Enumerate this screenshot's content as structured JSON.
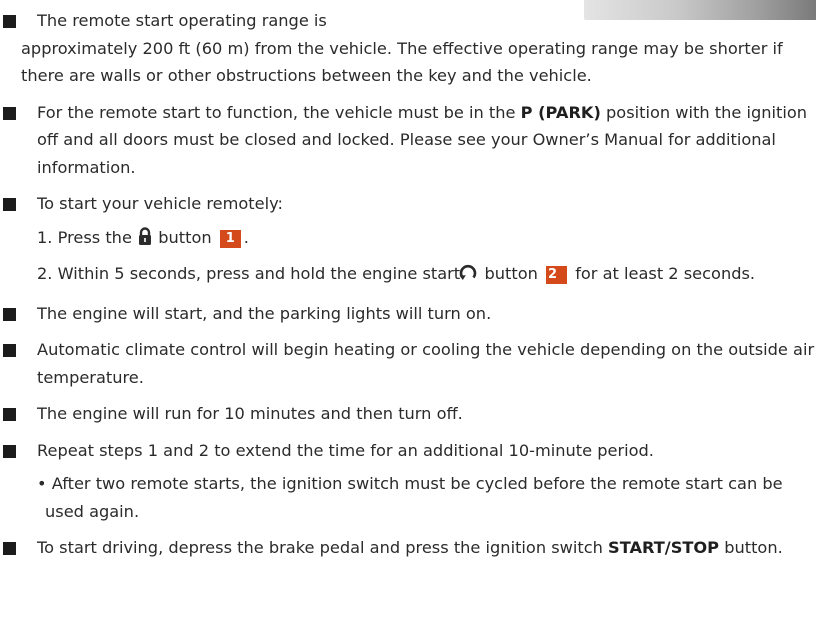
{
  "items": [
    {
      "id": "range",
      "line1": "The remote start operating range is",
      "line2": "approximately 200 ft (60 m) from the vehicle. The effective operating range may be shorter if there are walls or other obstructions between the key and the vehicle."
    },
    {
      "id": "function",
      "pre": "For the remote start to function, the vehicle must be in the ",
      "bold": "P (PARK)",
      "post": " position with the ignition off and all doors must be closed and locked. Please see your Owner’s Manual for additional information."
    },
    {
      "id": "start-steps",
      "text": "To start your vehicle remotely:",
      "step1_pre": "1. Press the",
      "step1_post": "button",
      "step1_badge": "1",
      "step2_pre": "2. Within 5 seconds, press and hold the engine start",
      "step2_mid": "button",
      "step2_badge": "2",
      "step2_post": "for at least 2 seconds."
    },
    {
      "id": "engine-start",
      "text": "The engine will start, and the parking lights will turn on."
    },
    {
      "id": "climate",
      "text": "Automatic climate control will begin heating or cooling the vehicle depending on the outside air temperature."
    },
    {
      "id": "run-time",
      "text": "The engine will run for 10 minutes and then turn off."
    },
    {
      "id": "repeat",
      "text": "Repeat steps 1 and 2 to extend the time for an additional 10-minute period.",
      "note": "• After two remote starts, the ignition switch must be cycled before the remote start can be used again."
    },
    {
      "id": "driving",
      "pre": "To start driving, depress the brake pedal and press the ignition switch ",
      "bold": "START/STOP",
      "post": " button."
    }
  ],
  "colors": {
    "badge": "#d44a1a",
    "bullet": "#1c1c1c",
    "text": "#2b2b2b"
  },
  "icons": [
    "lock-icon",
    "remote-start-icon"
  ]
}
